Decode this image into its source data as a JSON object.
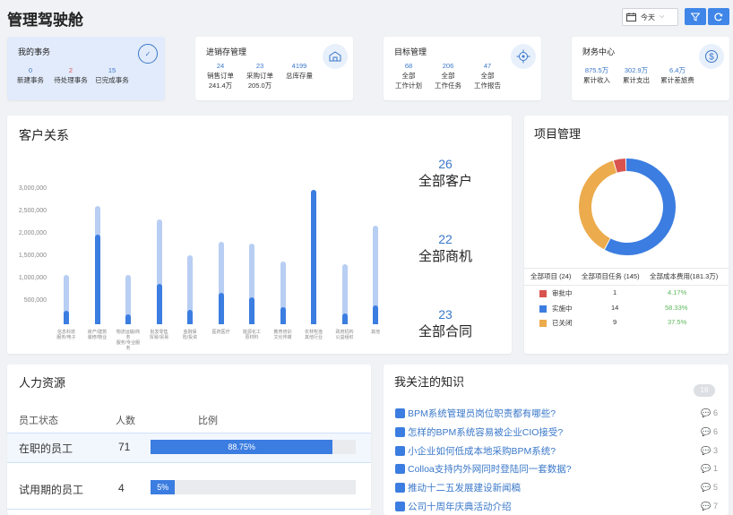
{
  "page": {
    "title": "管理驾驶舱",
    "date_select": "今天"
  },
  "summary": [
    {
      "title": "我的事务",
      "icon": "calendar-check-icon",
      "items": [
        {
          "value": "0",
          "label": "新建事务"
        },
        {
          "value": "2",
          "label": "待处理事务"
        },
        {
          "value": "15",
          "label": "已完成事务"
        }
      ]
    },
    {
      "title": "进销存管理",
      "icon": "warehouse-icon",
      "items": [
        {
          "value": "24",
          "label": "销售订单",
          "sub": "241.4万"
        },
        {
          "value": "23",
          "label": "采购订单",
          "sub": "205.0万"
        },
        {
          "value": "4199",
          "label": "总库存量"
        }
      ]
    },
    {
      "title": "目标管理",
      "icon": "target-icon",
      "items": [
        {
          "value": "68",
          "label": "全部",
          "sub": "工作计划"
        },
        {
          "value": "206",
          "label": "全部",
          "sub": "工作任务"
        },
        {
          "value": "47",
          "label": "全部",
          "sub": "工作报告"
        }
      ]
    },
    {
      "title": "财务中心",
      "icon": "dollar-icon",
      "items": [
        {
          "value": "875.5万",
          "label": "累计收入"
        },
        {
          "value": "302.9万",
          "label": "累计支出"
        },
        {
          "value": "6.4万",
          "label": "累计差旅费"
        }
      ]
    }
  ],
  "crm": {
    "title": "客户关系",
    "stats": [
      {
        "value": "26",
        "label": "全部客户"
      },
      {
        "value": "22",
        "label": "全部商机"
      },
      {
        "value": "23",
        "label": "全部合同"
      }
    ]
  },
  "chart_data": {
    "type": "bar",
    "y_ticks": [
      "3,000,000",
      "2,500,000",
      "2,000,000",
      "1,500,000",
      "1,000,000",
      "500,000"
    ],
    "ylim": [
      0,
      3500000
    ],
    "categories": [
      "信息科技服务",
      "房产建筑装修",
      "物流运输",
      "批发零售",
      "金融保险",
      "医药医疗",
      "能源化工",
      "教育培训",
      "农林牧渔",
      "政府机构",
      "其他"
    ],
    "x_labels": [
      [
        "信息科技",
        "服务/电子"
      ],
      [
        "房产/建筑",
        "装修/物业"
      ],
      [
        "物流运输/商务",
        "服务/专业服务"
      ],
      [
        "批发零售",
        "贸易/贸易"
      ],
      [
        "金融保",
        "险/投资"
      ],
      [
        "医药医疗",
        ""
      ],
      [
        "能源化工",
        "原材料"
      ],
      [
        "教育培训",
        "文化传媒"
      ],
      [
        "农林牧渔",
        "其他行业"
      ],
      [
        "政府机构",
        "公益组织"
      ],
      [
        "其他",
        ""
      ]
    ],
    "series": [
      {
        "values": [
          1100000,
          2650000,
          1100000,
          2350000,
          1550000,
          1850000,
          1800000,
          1400000,
          3000000,
          1350000,
          2200000
        ]
      },
      {
        "values": [
          300000,
          2000000,
          230000,
          900000,
          320000,
          700000,
          600000,
          380000,
          3000000,
          240000,
          420000
        ]
      }
    ]
  },
  "project": {
    "title": "项目管理",
    "headers": [
      "全部项目 (24)",
      "全部项目任务 (145)",
      "全部成本费用(181.3万)"
    ],
    "rows": [
      {
        "status": "审批中",
        "count": "1",
        "pct": "4.17%",
        "color": "#d9534f",
        "frac": 0.0417
      },
      {
        "status": "实施中",
        "count": "14",
        "pct": "58.33%",
        "color": "#3b7de0",
        "frac": 0.5833
      },
      {
        "status": "已关闭",
        "count": "9",
        "pct": "37.5%",
        "color": "#ecab4c",
        "frac": 0.375
      }
    ]
  },
  "hr": {
    "title": "人力资源",
    "headers": [
      "员工状态",
      "人数",
      "比例"
    ],
    "rows": [
      {
        "status": "在职的员工",
        "count": "71",
        "pct": "88.75%",
        "frac": 0.8875
      },
      {
        "status": "试用期的员工",
        "count": "4",
        "pct": "5%",
        "frac": 0.05
      }
    ]
  },
  "knowledge": {
    "title": "我关注的知识",
    "badge": "16",
    "items": [
      {
        "text": "BPM系统管理员岗位职责都有哪些?",
        "count": "6"
      },
      {
        "text": "怎样的BPM系统容易被企业CIO接受?",
        "count": "6"
      },
      {
        "text": "小企业如何低成本地采购BPM系统?",
        "count": "3"
      },
      {
        "text": "Colloa支持内外网同时登陆同一套数据?",
        "count": "1"
      },
      {
        "text": "推动十二五发展建设新闻稿",
        "count": "5"
      },
      {
        "text": "公司十周年庆典活动介绍",
        "count": "7"
      }
    ]
  }
}
